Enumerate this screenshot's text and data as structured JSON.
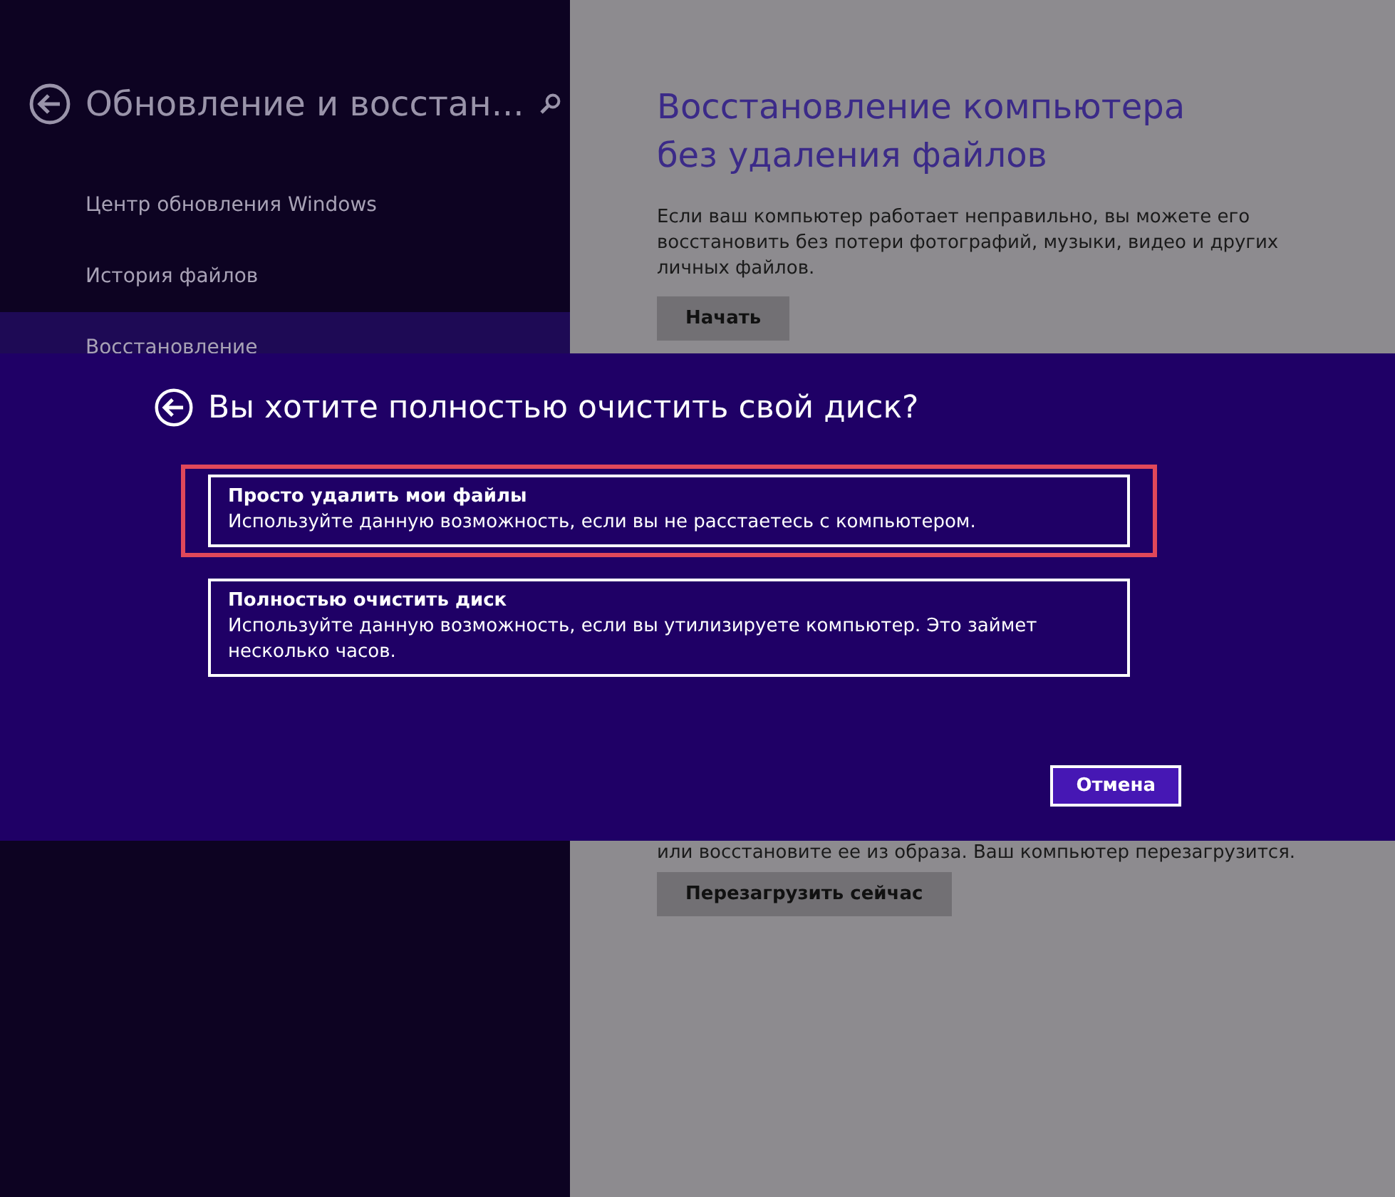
{
  "sidebar": {
    "title": "Обновление и восстан...",
    "items": [
      {
        "label": "Центр обновления Windows",
        "selected": false
      },
      {
        "label": "История файлов",
        "selected": false
      },
      {
        "label": "Восстановление",
        "selected": true
      }
    ]
  },
  "content": {
    "title": "Восстановление компьютера без удаления файлов",
    "description": "Если ваш компьютер работает неправильно, вы можете его восстановить без потери фотографий, музыки, видео и других личных файлов.",
    "button": "Начать",
    "lower_description": "или восстановите ее из образа. Ваш компьютер перезагрузится.",
    "lower_button": "Перезагрузить сейчас"
  },
  "dialog": {
    "title": "Вы хотите полностью очистить свой диск?",
    "options": [
      {
        "title": "Просто удалить мои файлы",
        "description": "Используйте данную возможность, если вы не расстаетесь с компьютером.",
        "highlighted": true
      },
      {
        "title": "Полностью очистить диск",
        "description": "Используйте данную возможность, если вы утилизируете компьютер. Это займет несколько часов.",
        "highlighted": false
      }
    ],
    "cancel": "Отмена"
  }
}
